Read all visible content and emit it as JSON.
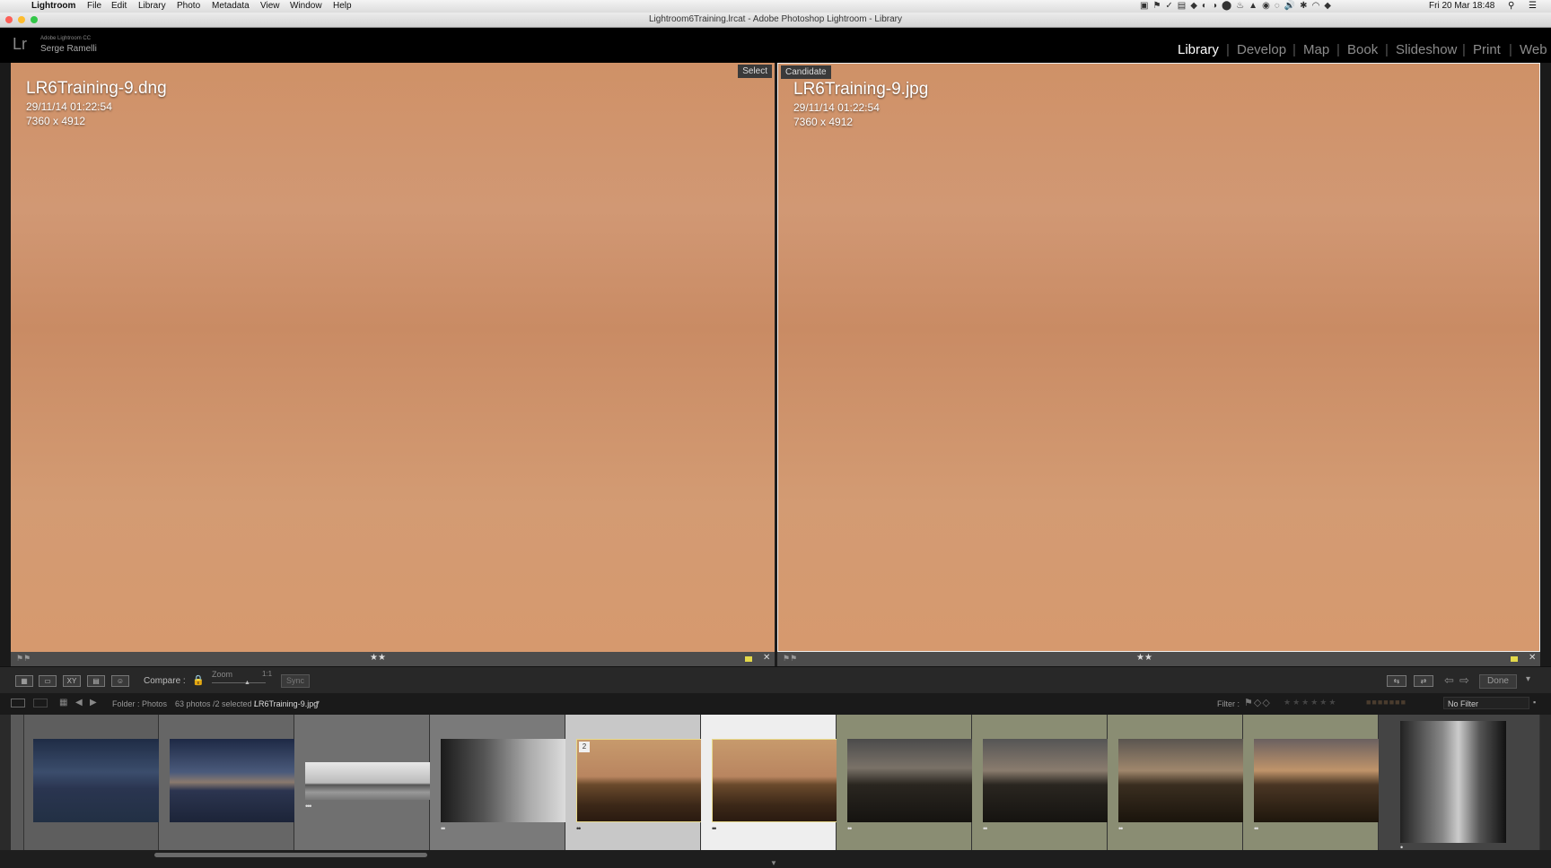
{
  "menubar": {
    "apple": "",
    "app_name": "Lightroom",
    "items": [
      "File",
      "Edit",
      "Library",
      "Photo",
      "Metadata",
      "View",
      "Window",
      "Help"
    ],
    "clock": "Fri 20 Mar  18:48"
  },
  "window": {
    "title": "Lightroom6Training.lrcat - Adobe Photoshop Lightroom - Library"
  },
  "identity": {
    "logo": "Lr",
    "product": "Adobe Lightroom CC",
    "user": "Serge Ramelli",
    "modules": [
      "Library",
      "Develop",
      "Map",
      "Book",
      "Slideshow",
      "Print",
      "Web"
    ],
    "active_module": "Library"
  },
  "compare": {
    "select": {
      "tag": "Select",
      "filename": "LR6Training-9.dng",
      "date": "29/11/14 01:22:54",
      "dimensions": "7360 x 4912",
      "stars": "★★"
    },
    "candidate": {
      "tag": "Candidate",
      "filename": "LR6Training-9.jpg",
      "date": "29/11/14 01:22:54",
      "dimensions": "7360 x 4912",
      "stars": "★★"
    }
  },
  "toolbar": {
    "compare_label": "Compare :",
    "zoom_label": "Zoom",
    "zoom_value": "1:1",
    "sync_label": "Sync",
    "done_label": "Done"
  },
  "filmstrip_header": {
    "folder": "Folder : Photos",
    "count": "63 photos /2 selected /",
    "current_file": "LR6Training-9.jpg",
    "filter_label": "Filter :",
    "filter_value": "No Filter"
  },
  "filmstrip": {
    "badge": "2",
    "thumb_ratings": [
      "••",
      "••",
      "•••",
      "••",
      "••",
      "••",
      "••",
      "••",
      "••",
      "••",
      "•"
    ]
  },
  "colors": {
    "pane_orange": "#d19874",
    "active_module": "#ffffff",
    "inactive_module": "#8c8c8c",
    "select_border": "#e8d98a",
    "cell_selected": "#c8c8c8",
    "cell_candidate": "#eeeeee",
    "cell_green": "#8a8d73"
  }
}
